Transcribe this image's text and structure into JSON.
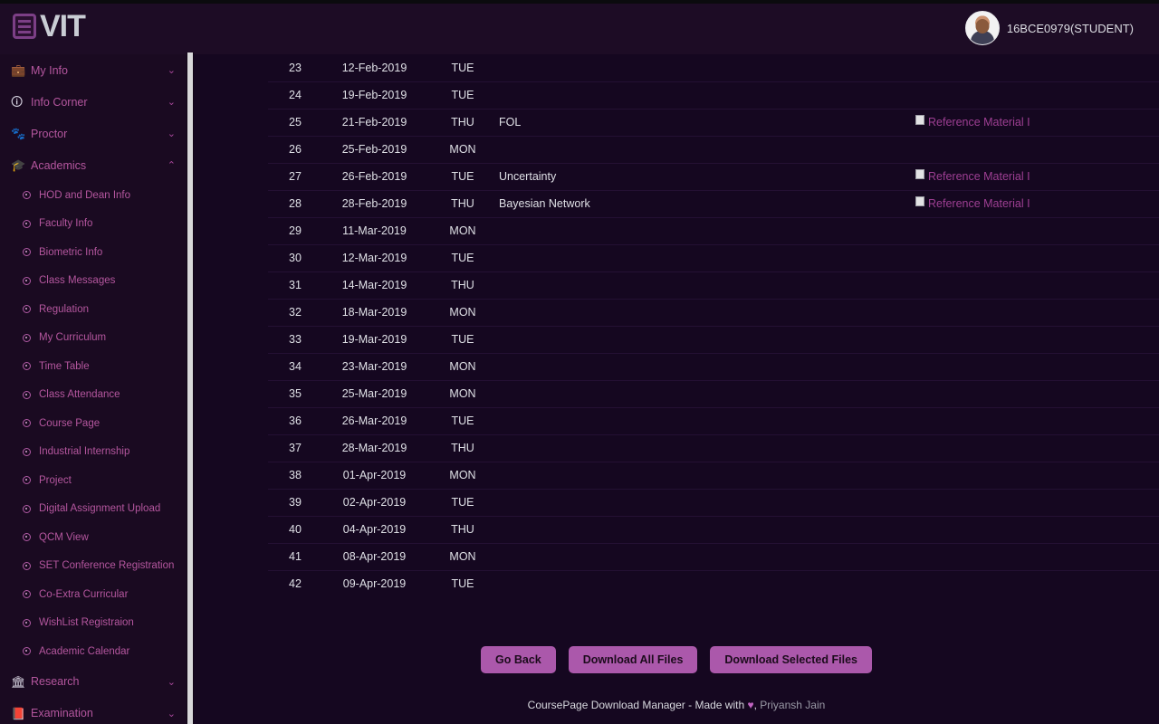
{
  "header": {
    "brand": "VIT",
    "brand_icon": "list-square-icon",
    "user_label": "16BCE0979(STUDENT)",
    "avatar_icon": "user-avatar"
  },
  "colors": {
    "page_bg": "#120617",
    "header_bg": "#1d0c25",
    "sidebar_bg": "#1a0a21",
    "content_bg": "#150720",
    "accent_link": "#b4569e",
    "button_bg": "#ab58ab",
    "ref_link": "#9e3f93",
    "text": "#dfe0e6"
  },
  "sidebar": {
    "groups": [
      {
        "label": "My Info",
        "icon": "briefcase-icon",
        "chevron": "⌄",
        "expanded": false
      },
      {
        "label": "Info Corner",
        "icon": "info-circle-icon",
        "chevron": "⌄",
        "expanded": false
      },
      {
        "label": "Proctor",
        "icon": "paw-icon",
        "chevron": "⌄",
        "expanded": false
      },
      {
        "label": "Academics",
        "icon": "graduation-cap-icon",
        "chevron": "⌃",
        "expanded": true
      }
    ],
    "academics_items": [
      {
        "label": "HOD and Dean Info"
      },
      {
        "label": "Faculty Info"
      },
      {
        "label": "Biometric Info"
      },
      {
        "label": "Class Messages"
      },
      {
        "label": "Regulation"
      },
      {
        "label": "My Curriculum"
      },
      {
        "label": "Time Table"
      },
      {
        "label": "Class Attendance"
      },
      {
        "label": "Course Page"
      },
      {
        "label": "Industrial Internship"
      },
      {
        "label": "Project"
      },
      {
        "label": "Digital Assignment Upload"
      },
      {
        "label": "QCM View"
      },
      {
        "label": "SET Conference Registration"
      },
      {
        "label": "Co-Extra Curricular"
      },
      {
        "label": "WishList Registraion"
      },
      {
        "label": "Academic Calendar"
      }
    ],
    "bottom_groups": [
      {
        "label": "Research",
        "icon": "bank-icon",
        "chevron": "⌄",
        "expanded": false
      },
      {
        "label": "Examination",
        "icon": "book-icon",
        "chevron": "⌄",
        "expanded": false
      }
    ]
  },
  "table": {
    "rows": [
      {
        "no": "23",
        "date": "12-Feb-2019",
        "day": "TUE",
        "topic": "",
        "ref": ""
      },
      {
        "no": "24",
        "date": "19-Feb-2019",
        "day": "TUE",
        "topic": "",
        "ref": ""
      },
      {
        "no": "25",
        "date": "21-Feb-2019",
        "day": "THU",
        "topic": "FOL",
        "ref": "Reference Material I"
      },
      {
        "no": "26",
        "date": "25-Feb-2019",
        "day": "MON",
        "topic": "",
        "ref": ""
      },
      {
        "no": "27",
        "date": "26-Feb-2019",
        "day": "TUE",
        "topic": "Uncertainty",
        "ref": "Reference Material I"
      },
      {
        "no": "28",
        "date": "28-Feb-2019",
        "day": "THU",
        "topic": "Bayesian Network",
        "ref": "Reference Material I"
      },
      {
        "no": "29",
        "date": "11-Mar-2019",
        "day": "MON",
        "topic": "",
        "ref": ""
      },
      {
        "no": "30",
        "date": "12-Mar-2019",
        "day": "TUE",
        "topic": "",
        "ref": ""
      },
      {
        "no": "31",
        "date": "14-Mar-2019",
        "day": "THU",
        "topic": "",
        "ref": ""
      },
      {
        "no": "32",
        "date": "18-Mar-2019",
        "day": "MON",
        "topic": "",
        "ref": ""
      },
      {
        "no": "33",
        "date": "19-Mar-2019",
        "day": "TUE",
        "topic": "",
        "ref": ""
      },
      {
        "no": "34",
        "date": "23-Mar-2019",
        "day": "MON",
        "topic": "",
        "ref": ""
      },
      {
        "no": "35",
        "date": "25-Mar-2019",
        "day": "MON",
        "topic": "",
        "ref": ""
      },
      {
        "no": "36",
        "date": "26-Mar-2019",
        "day": "TUE",
        "topic": "",
        "ref": ""
      },
      {
        "no": "37",
        "date": "28-Mar-2019",
        "day": "THU",
        "topic": "",
        "ref": ""
      },
      {
        "no": "38",
        "date": "01-Apr-2019",
        "day": "MON",
        "topic": "",
        "ref": ""
      },
      {
        "no": "39",
        "date": "02-Apr-2019",
        "day": "TUE",
        "topic": "",
        "ref": ""
      },
      {
        "no": "40",
        "date": "04-Apr-2019",
        "day": "THU",
        "topic": "",
        "ref": ""
      },
      {
        "no": "41",
        "date": "08-Apr-2019",
        "day": "MON",
        "topic": "",
        "ref": ""
      },
      {
        "no": "42",
        "date": "09-Apr-2019",
        "day": "TUE",
        "topic": "",
        "ref": ""
      }
    ]
  },
  "buttons": {
    "go_back": "Go Back",
    "download_all": "Download All Files",
    "download_selected": "Download Selected Files"
  },
  "footer": {
    "prefix": "CoursePage Download Manager - Made with ",
    "heart": "♥",
    "comma": ", ",
    "author": "Priyansh Jain"
  }
}
